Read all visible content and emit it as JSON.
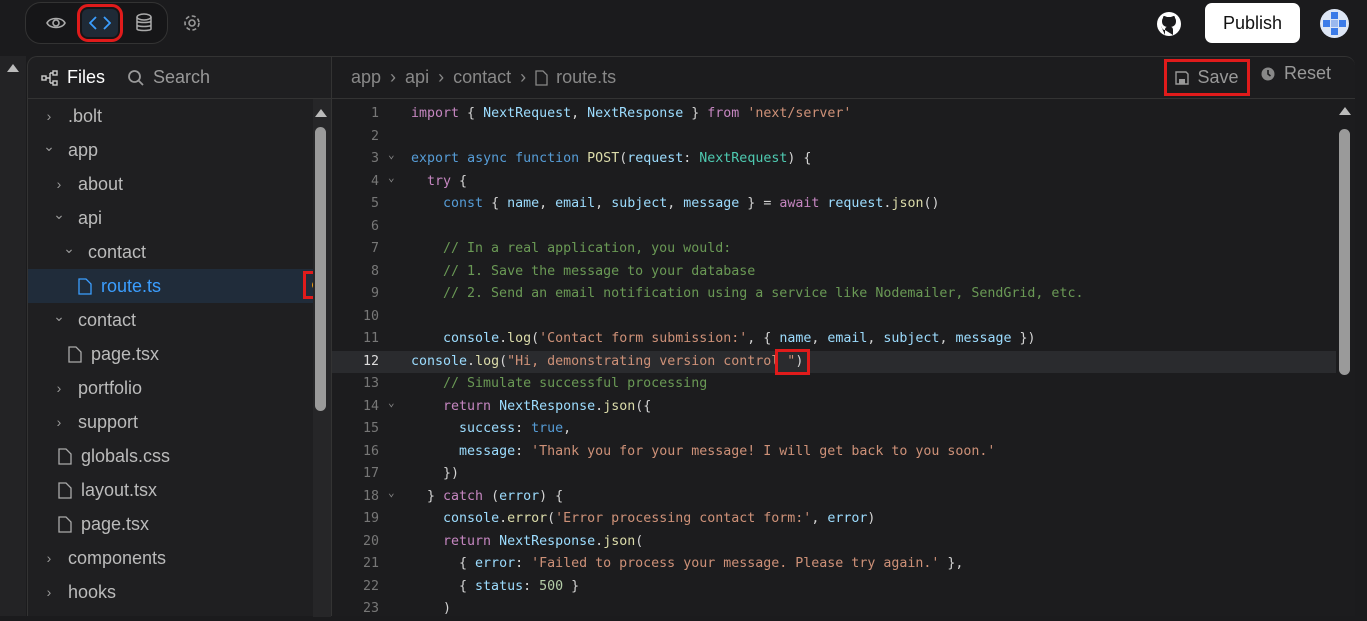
{
  "header": {
    "publish_label": "Publish",
    "view_modes": [
      "preview",
      "code",
      "database"
    ],
    "active_view": "code"
  },
  "sidebar": {
    "tabs": {
      "files": "Files",
      "search": "Search"
    },
    "items": [
      {
        "label": ".bolt",
        "type": "folder",
        "open": false,
        "depth": 0
      },
      {
        "label": "app",
        "type": "folder",
        "open": true,
        "depth": 0
      },
      {
        "label": "about",
        "type": "folder",
        "open": false,
        "depth": 1
      },
      {
        "label": "api",
        "type": "folder",
        "open": true,
        "depth": 1
      },
      {
        "label": "contact",
        "type": "folder",
        "open": true,
        "depth": 2
      },
      {
        "label": "route.ts",
        "type": "file",
        "depth": 3,
        "selected": true,
        "modified": true
      },
      {
        "label": "contact",
        "type": "folder",
        "open": true,
        "depth": 1
      },
      {
        "label": "page.tsx",
        "type": "file",
        "depth": 2
      },
      {
        "label": "portfolio",
        "type": "folder",
        "open": false,
        "depth": 1
      },
      {
        "label": "support",
        "type": "folder",
        "open": false,
        "depth": 1
      },
      {
        "label": "globals.css",
        "type": "file",
        "depth": 1
      },
      {
        "label": "layout.tsx",
        "type": "file",
        "depth": 1
      },
      {
        "label": "page.tsx",
        "type": "file",
        "depth": 1
      },
      {
        "label": "components",
        "type": "folder",
        "open": false,
        "depth": 0
      },
      {
        "label": "hooks",
        "type": "folder",
        "open": false,
        "depth": 0
      }
    ]
  },
  "editor": {
    "breadcrumb": [
      "app",
      "api",
      "contact",
      "route.ts"
    ],
    "save_label": "Save",
    "reset_label": "Reset",
    "current_line": 12,
    "colors": {
      "modified_dot": "#f59e0b",
      "accent": "#3b9eff"
    },
    "lines": [
      [
        [
          "k",
          "import"
        ],
        [
          "p",
          " { "
        ],
        [
          "v",
          "NextRequest"
        ],
        [
          "p",
          ", "
        ],
        [
          "v",
          "NextResponse"
        ],
        [
          "p",
          " } "
        ],
        [
          "k",
          "from"
        ],
        [
          "p",
          " "
        ],
        [
          "s",
          "'next/server'"
        ]
      ],
      [],
      [
        [
          "b",
          "export"
        ],
        [
          "p",
          " "
        ],
        [
          "b",
          "async"
        ],
        [
          "p",
          " "
        ],
        [
          "b",
          "function"
        ],
        [
          "p",
          " "
        ],
        [
          "f",
          "POST"
        ],
        [
          "p",
          "("
        ],
        [
          "v",
          "request"
        ],
        [
          "p",
          ": "
        ],
        [
          "t",
          "NextRequest"
        ],
        [
          "p",
          ") {"
        ]
      ],
      [
        [
          "p",
          "  "
        ],
        [
          "k",
          "try"
        ],
        [
          "p",
          " {"
        ]
      ],
      [
        [
          "p",
          "    "
        ],
        [
          "b",
          "const"
        ],
        [
          "p",
          " { "
        ],
        [
          "v",
          "name"
        ],
        [
          "p",
          ", "
        ],
        [
          "v",
          "email"
        ],
        [
          "p",
          ", "
        ],
        [
          "v",
          "subject"
        ],
        [
          "p",
          ", "
        ],
        [
          "v",
          "message"
        ],
        [
          "p",
          " } = "
        ],
        [
          "k",
          "await"
        ],
        [
          "p",
          " "
        ],
        [
          "v",
          "request"
        ],
        [
          "p",
          "."
        ],
        [
          "f",
          "json"
        ],
        [
          "p",
          "()"
        ]
      ],
      [],
      [
        [
          "c",
          "    // In a real application, you would:"
        ]
      ],
      [
        [
          "c",
          "    // 1. Save the message to your database"
        ]
      ],
      [
        [
          "c",
          "    // 2. Send an email notification using a service like Nodemailer, SendGrid, etc."
        ]
      ],
      [],
      [
        [
          "p",
          "    "
        ],
        [
          "v",
          "console"
        ],
        [
          "p",
          "."
        ],
        [
          "f",
          "log"
        ],
        [
          "p",
          "("
        ],
        [
          "s",
          "'Contact form submission:'"
        ],
        [
          "p",
          ", { "
        ],
        [
          "v",
          "name"
        ],
        [
          "p",
          ", "
        ],
        [
          "v",
          "email"
        ],
        [
          "p",
          ", "
        ],
        [
          "v",
          "subject"
        ],
        [
          "p",
          ", "
        ],
        [
          "v",
          "message"
        ],
        [
          "p",
          " })"
        ]
      ],
      [
        [
          "v",
          "console"
        ],
        [
          "p",
          "."
        ],
        [
          "f",
          "log"
        ],
        [
          "p",
          "("
        ],
        [
          "s",
          "\"Hi, demonstrating version control \""
        ],
        [
          "p",
          ")"
        ]
      ],
      [
        [
          "c",
          "    // Simulate successful processing"
        ]
      ],
      [
        [
          "p",
          "    "
        ],
        [
          "k",
          "return"
        ],
        [
          "p",
          " "
        ],
        [
          "v",
          "NextResponse"
        ],
        [
          "p",
          "."
        ],
        [
          "f",
          "json"
        ],
        [
          "p",
          "({"
        ]
      ],
      [
        [
          "p",
          "      "
        ],
        [
          "v",
          "success"
        ],
        [
          "p",
          ": "
        ],
        [
          "b",
          "true"
        ],
        [
          "p",
          ","
        ]
      ],
      [
        [
          "p",
          "      "
        ],
        [
          "v",
          "message"
        ],
        [
          "p",
          ": "
        ],
        [
          "s",
          "'Thank you for your message! I will get back to you soon.'"
        ]
      ],
      [
        [
          "p",
          "    })"
        ]
      ],
      [
        [
          "p",
          "  } "
        ],
        [
          "k",
          "catch"
        ],
        [
          "p",
          " ("
        ],
        [
          "v",
          "error"
        ],
        [
          "p",
          ") {"
        ]
      ],
      [
        [
          "p",
          "    "
        ],
        [
          "v",
          "console"
        ],
        [
          "p",
          "."
        ],
        [
          "f",
          "error"
        ],
        [
          "p",
          "("
        ],
        [
          "s",
          "'Error processing contact form:'"
        ],
        [
          "p",
          ", "
        ],
        [
          "v",
          "error"
        ],
        [
          "p",
          ")"
        ]
      ],
      [
        [
          "p",
          "    "
        ],
        [
          "k",
          "return"
        ],
        [
          "p",
          " "
        ],
        [
          "v",
          "NextResponse"
        ],
        [
          "p",
          "."
        ],
        [
          "f",
          "json"
        ],
        [
          "p",
          "("
        ]
      ],
      [
        [
          "p",
          "      { "
        ],
        [
          "v",
          "error"
        ],
        [
          "p",
          ": "
        ],
        [
          "s",
          "'Failed to process your message. Please try again.'"
        ],
        [
          "p",
          " },"
        ]
      ],
      [
        [
          "p",
          "      { "
        ],
        [
          "v",
          "status"
        ],
        [
          "p",
          ": "
        ],
        [
          "n",
          "500"
        ],
        [
          "p",
          " }"
        ]
      ],
      [
        [
          "p",
          "    )"
        ]
      ]
    ],
    "folds": [
      3,
      4,
      14,
      18
    ]
  }
}
